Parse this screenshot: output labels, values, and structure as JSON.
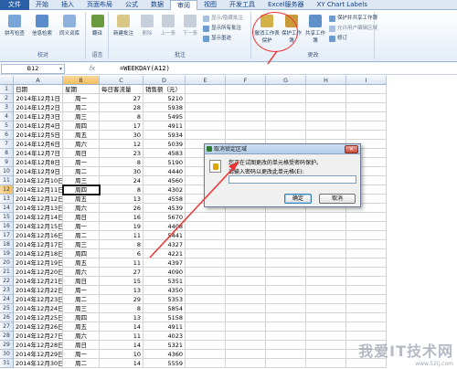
{
  "tabs": [
    "文件",
    "开始",
    "插入",
    "页面布局",
    "公式",
    "数据",
    "审阅",
    "视图",
    "开发工具",
    "Excel服务器",
    "XY Chart Labels"
  ],
  "active_tab": "审阅",
  "ribbon": {
    "groups": [
      {
        "label": "校对",
        "buttons": [
          "拼写检查",
          "信息检索",
          "同义词库"
        ]
      },
      {
        "label": "语言",
        "buttons": [
          "翻译"
        ]
      },
      {
        "label": "批注",
        "buttons": [
          "新建批注",
          "删除",
          "上一条",
          "下一条"
        ],
        "small": [
          "显示/隐藏批注",
          "显示所有批注",
          "显示墨迹"
        ]
      },
      {
        "label": "更改",
        "buttons": [
          "撤消工作表保护",
          "保护工作簿",
          "共享工作簿"
        ],
        "small": [
          "保护并共享工作簿",
          "允许用户编辑区域",
          "修订"
        ]
      }
    ]
  },
  "formula_bar": {
    "name_box": "B12",
    "fx": "fx",
    "formula": "=WEEKDAY(A12)"
  },
  "columns": [
    "A",
    "B",
    "C",
    "D",
    "E",
    "F",
    "G",
    "H",
    "I"
  ],
  "headers": [
    "日期",
    "星期",
    "每日客流量",
    "销售额（元）"
  ],
  "rows": [
    [
      "2014年12月1日",
      "周一",
      "27",
      "5210"
    ],
    [
      "2014年12月2日",
      "周二",
      "28",
      "5938"
    ],
    [
      "2014年12月3日",
      "周三",
      "8",
      "5495"
    ],
    [
      "2014年12月4日",
      "周四",
      "17",
      "4911"
    ],
    [
      "2014年12月5日",
      "周五",
      "30",
      "5934"
    ],
    [
      "2014年12月6日",
      "周六",
      "12",
      "5039"
    ],
    [
      "2014年12月7日",
      "周日",
      "23",
      "4583"
    ],
    [
      "2014年12月8日",
      "周一",
      "8",
      "5190"
    ],
    [
      "2014年12月9日",
      "周二",
      "30",
      "4440"
    ],
    [
      "2014年12月10日",
      "周三",
      "24",
      "4560"
    ],
    [
      "2014年12月11日",
      "周四",
      "8",
      "4302"
    ],
    [
      "2014年12月12日",
      "周五",
      "13",
      "4558"
    ],
    [
      "2014年12月13日",
      "周六",
      "26",
      "4539"
    ],
    [
      "2014年12月14日",
      "周日",
      "16",
      "5670"
    ],
    [
      "2014年12月15日",
      "周一",
      "19",
      "4408"
    ],
    [
      "2014年12月16日",
      "周二",
      "11",
      "5441"
    ],
    [
      "2014年12月17日",
      "周三",
      "8",
      "4327"
    ],
    [
      "2014年12月18日",
      "周四",
      "6",
      "4221"
    ],
    [
      "2014年12月19日",
      "周五",
      "11",
      "4397"
    ],
    [
      "2014年12月20日",
      "周六",
      "27",
      "4090"
    ],
    [
      "2014年12月21日",
      "周日",
      "15",
      "5351"
    ],
    [
      "2014年12月22日",
      "周一",
      "13",
      "4350"
    ],
    [
      "2014年12月23日",
      "周二",
      "29",
      "5353"
    ],
    [
      "2014年12月24日",
      "周三",
      "8",
      "5854"
    ],
    [
      "2014年12月25日",
      "周四",
      "13",
      "5158"
    ],
    [
      "2014年12月26日",
      "周五",
      "14",
      "4911"
    ],
    [
      "2014年12月27日",
      "周六",
      "11",
      "4023"
    ],
    [
      "2014年12月28日",
      "周日",
      "14",
      "5321"
    ],
    [
      "2014年12月29日",
      "周一",
      "10",
      "4360"
    ],
    [
      "2014年12月30日",
      "周二",
      "14",
      "5559"
    ]
  ],
  "selected_row": 12,
  "selected_col": "B",
  "dialog": {
    "title": "取消锁定区域",
    "message": "您正在试图更改的单元格受密码保护。",
    "prompt": "请输入密码以更改此单元格(E):",
    "ok": "确定",
    "cancel": "取消"
  },
  "watermark": {
    "main": "我爱IT技术网",
    "url": "www.52ij.com"
  },
  "colors": {
    "accent": "#2a5fa8",
    "annotation": "#e33333"
  }
}
